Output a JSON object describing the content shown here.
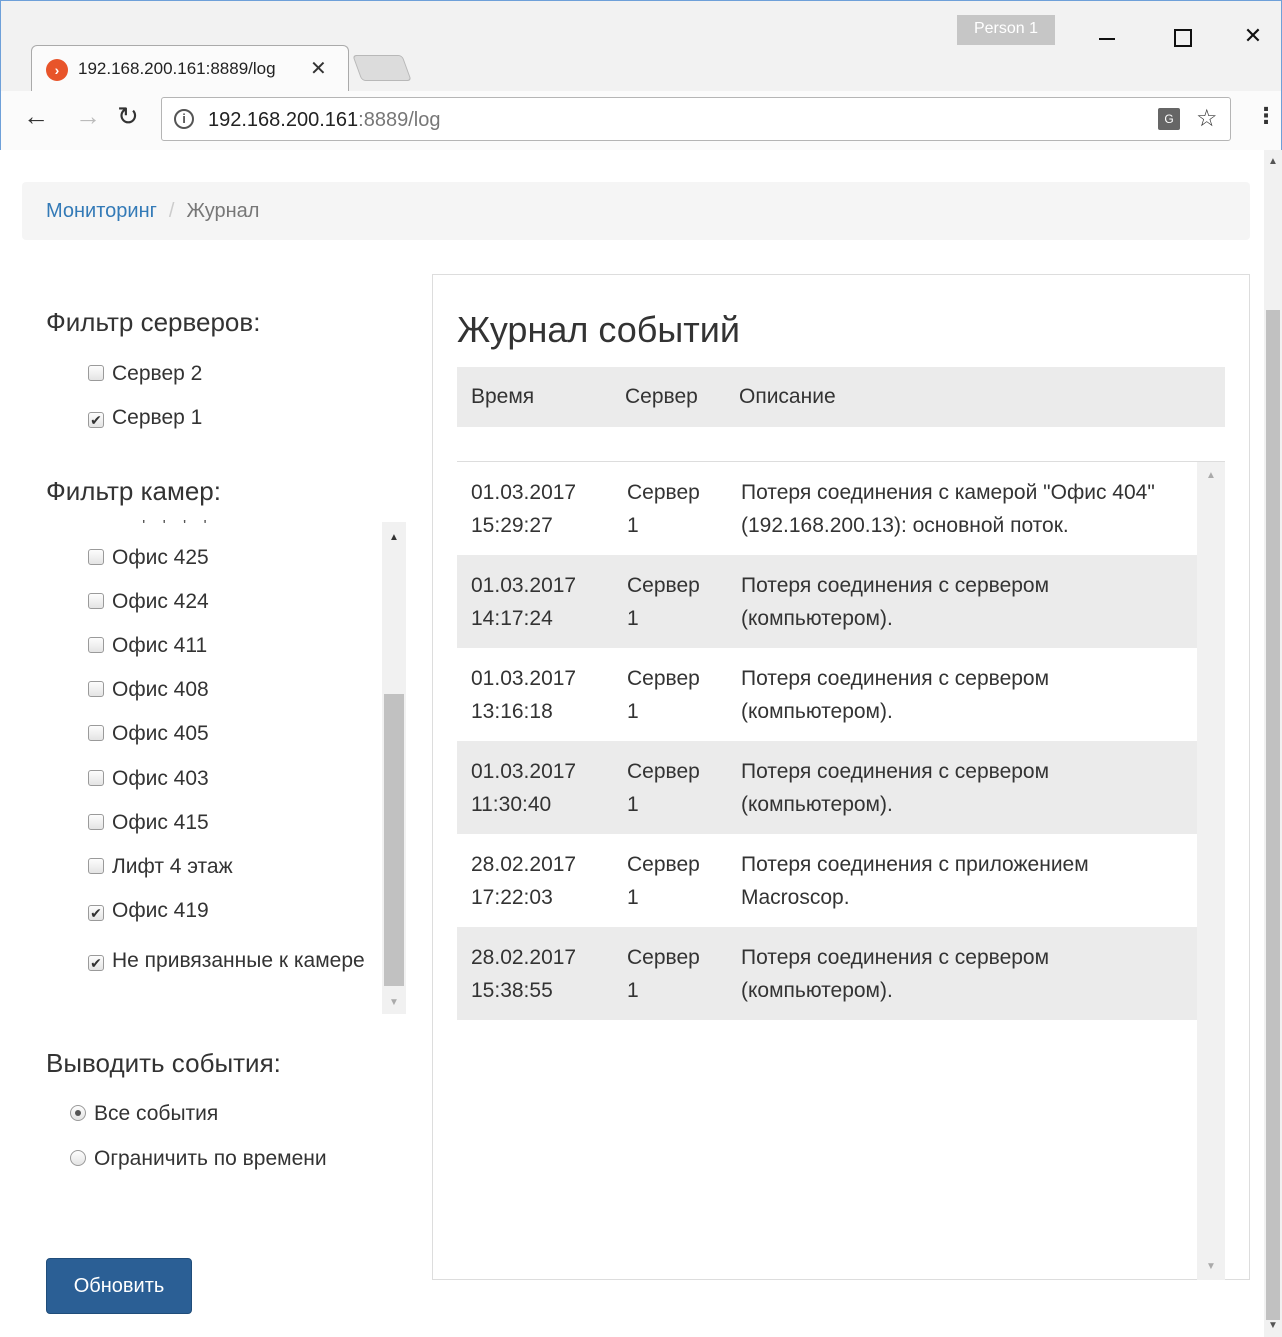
{
  "browser": {
    "person": "Person 1",
    "tab_title": "192.168.200.161:8889/log",
    "url_host": "192.168.200.161",
    "url_rest": ":8889/log"
  },
  "breadcrumb": {
    "root": "Мониторинг",
    "separator": "/",
    "current": "Журнал"
  },
  "server_filter": {
    "title": "Фильтр серверов:",
    "items": [
      {
        "label": "Сервер 2",
        "checked": false
      },
      {
        "label": "Сервер 1",
        "checked": true
      }
    ]
  },
  "camera_filter": {
    "title": "Фильтр камер:",
    "items": [
      {
        "label": "Офис 425",
        "checked": false
      },
      {
        "label": "Офис 424",
        "checked": false
      },
      {
        "label": "Офис 411",
        "checked": false
      },
      {
        "label": "Офис 408",
        "checked": false
      },
      {
        "label": "Офис 405",
        "checked": false
      },
      {
        "label": "Офис 403",
        "checked": false
      },
      {
        "label": "Офис 415",
        "checked": false
      },
      {
        "label": "Лифт 4 этаж",
        "checked": false
      },
      {
        "label": "Офис 419",
        "checked": true
      },
      {
        "label": "Не привязанные к камере",
        "checked": true
      }
    ]
  },
  "events_filter": {
    "title": "Выводить события:",
    "options": [
      {
        "label": "Все события",
        "selected": true
      },
      {
        "label": "Ограничить по времени",
        "selected": false
      }
    ]
  },
  "refresh_button": "Обновить",
  "log": {
    "title": "Журнал событий",
    "columns": [
      "Время",
      "Сервер",
      "Описание"
    ],
    "rows": [
      {
        "date": "01.03.2017",
        "time": "15:29:27",
        "server": "Сервер",
        "server_num": "1",
        "desc": "Потеря соединения с камерой \"Офис 404\" (192.168.200.13): основной поток."
      },
      {
        "date": "01.03.2017",
        "time": "14:17:24",
        "server": "Сервер",
        "server_num": "1",
        "desc": "Потеря соединения с сервером (компьютером)."
      },
      {
        "date": "01.03.2017",
        "time": "13:16:18",
        "server": "Сервер",
        "server_num": "1",
        "desc": "Потеря соединения с сервером (компьютером)."
      },
      {
        "date": "01.03.2017",
        "time": "11:30:40",
        "server": "Сервер",
        "server_num": "1",
        "desc": "Потеря соединения с сервером (компьютером)."
      },
      {
        "date": "28.02.2017",
        "time": "17:22:03",
        "server": "Сервер",
        "server_num": "1",
        "desc": "Потеря соединения с приложением Macroscop."
      },
      {
        "date": "28.02.2017",
        "time": "15:38:55",
        "server": "Сервер",
        "server_num": "1",
        "desc": "Потеря соединения с сервером (компьютером)."
      }
    ]
  },
  "colors": {
    "link": "#337ab7",
    "primary_button": "#2b5f95",
    "row_alt": "#ebebeb"
  }
}
